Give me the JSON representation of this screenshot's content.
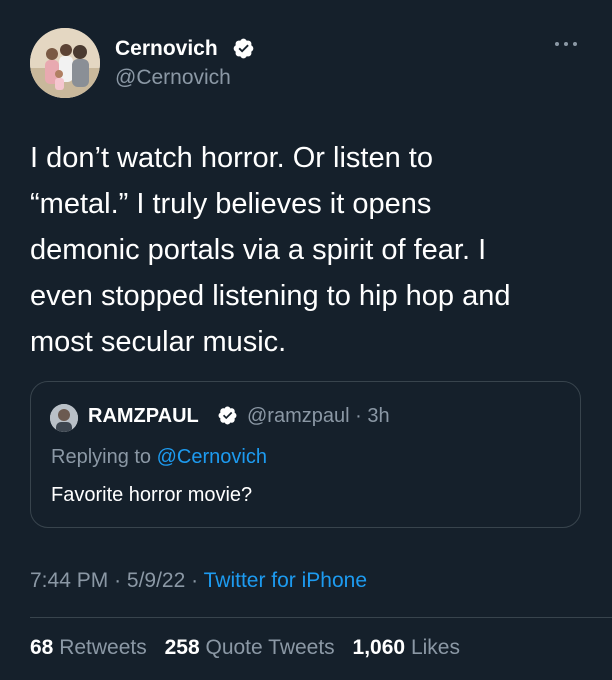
{
  "tweet": {
    "author_name": "Cernovich",
    "handle": "@Cernovich",
    "text_lines": [
      "I don’t watch horror. Or listen to",
      "“metal.” I truly believes it opens",
      "demonic portals via a spirit of fear. I",
      "even stopped listening to hip hop and",
      "most secular music."
    ],
    "more_icon": "more-options-icon",
    "verified_icon": "verified-badge-icon"
  },
  "quoted": {
    "author_name": "RAMZPAUL",
    "handle": "@ramzpaul",
    "separator": "·",
    "age": "3h",
    "replying_prefix": "Replying to",
    "replying_to": "@Cernovich",
    "text": "Favorite horror movie?"
  },
  "meta": {
    "time": "7:44 PM",
    "separator": "·",
    "date": "5/9/22",
    "source": "Twitter for iPhone"
  },
  "stats": {
    "retweets_count": "68",
    "retweets_label": "Retweets",
    "quotes_count": "258",
    "quotes_label": "Quote Tweets",
    "likes_count": "1,060",
    "likes_label": "Likes"
  },
  "colors": {
    "background": "#15202b",
    "accent": "#1d9bf0",
    "secondary_text": "#8b98a5",
    "border": "#38444d"
  }
}
